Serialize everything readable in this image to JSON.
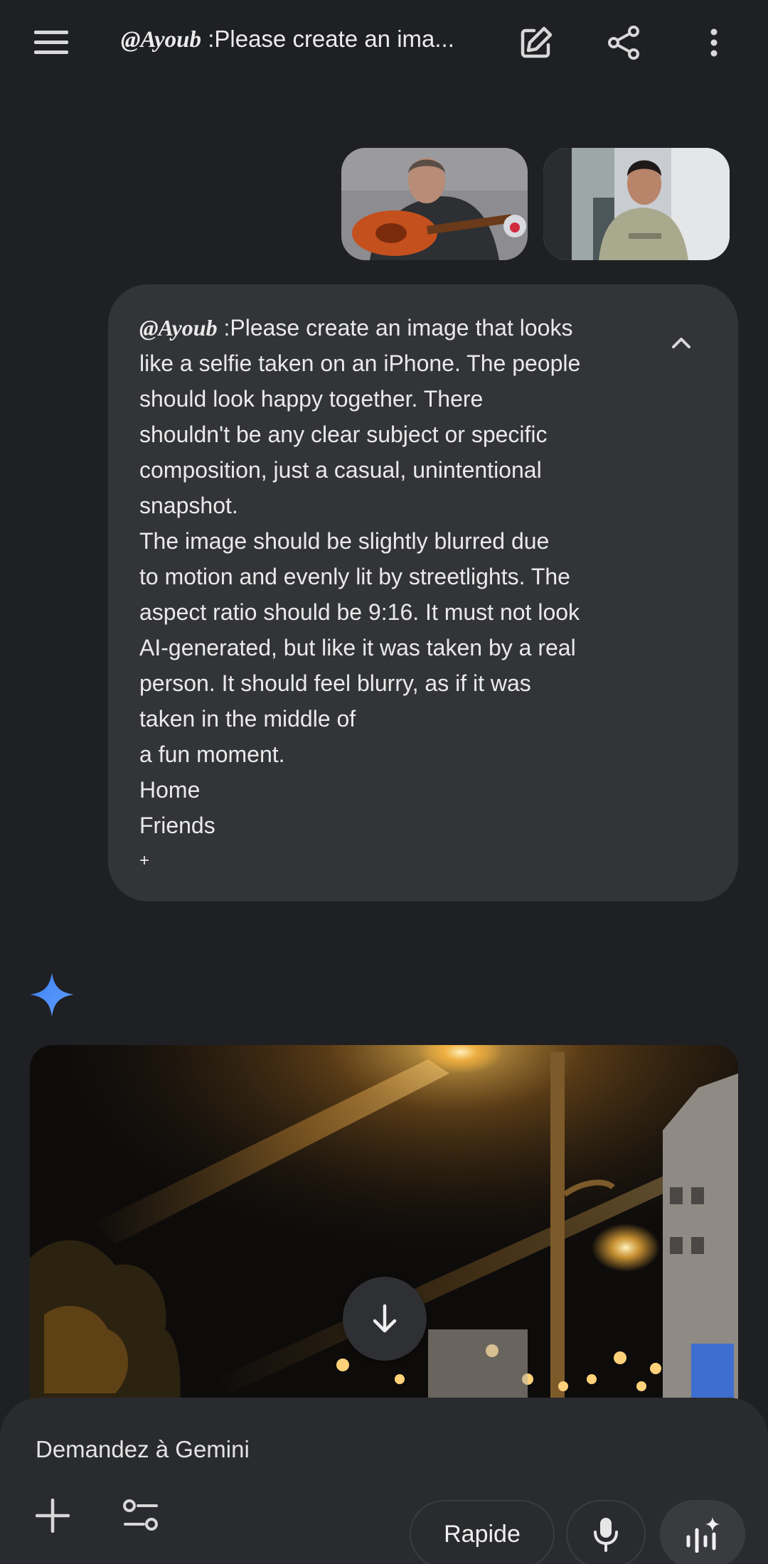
{
  "topbar": {
    "title_handle": "@Ayoub",
    "title_rest": " :Please create an ima..."
  },
  "icons": {
    "menu": "menu-icon",
    "edit": "edit-icon",
    "share": "share-icon",
    "more": "more-vert-icon",
    "collapse": "chevron-up-icon",
    "spark": "gemini-spark-icon",
    "scroll": "arrow-down-icon",
    "add": "plus-icon",
    "tools": "tools-icon",
    "mic": "mic-icon",
    "live": "live-icon"
  },
  "message": {
    "handle": "@Ayoub",
    "first_line_rest": " :Please create an image that looks",
    "lines": [
      "like a selfie taken on an iPhone. The people",
      "should look happy together. There",
      "shouldn't be any clear subject or specific",
      "composition, just a casual, unintentional",
      "snapshot.",
      "The image should be slightly blurred due",
      "to motion and evenly lit by streetlights. The",
      "aspect ratio should be 9:16. It must not look",
      "AI-generated, but like it was taken by a real",
      "person. It should feel blurry, as if it was",
      "taken in the middle of",
      "a fun moment.",
      "Home",
      "Friends",
      "+"
    ]
  },
  "composer": {
    "placeholder": "Demandez à Gemini",
    "mode_label": "Rapide"
  },
  "colors": {
    "background": "#1f2023",
    "bubble": "#333437",
    "composer": "#2a2b2e",
    "spark_blue": "#4f8df7"
  }
}
